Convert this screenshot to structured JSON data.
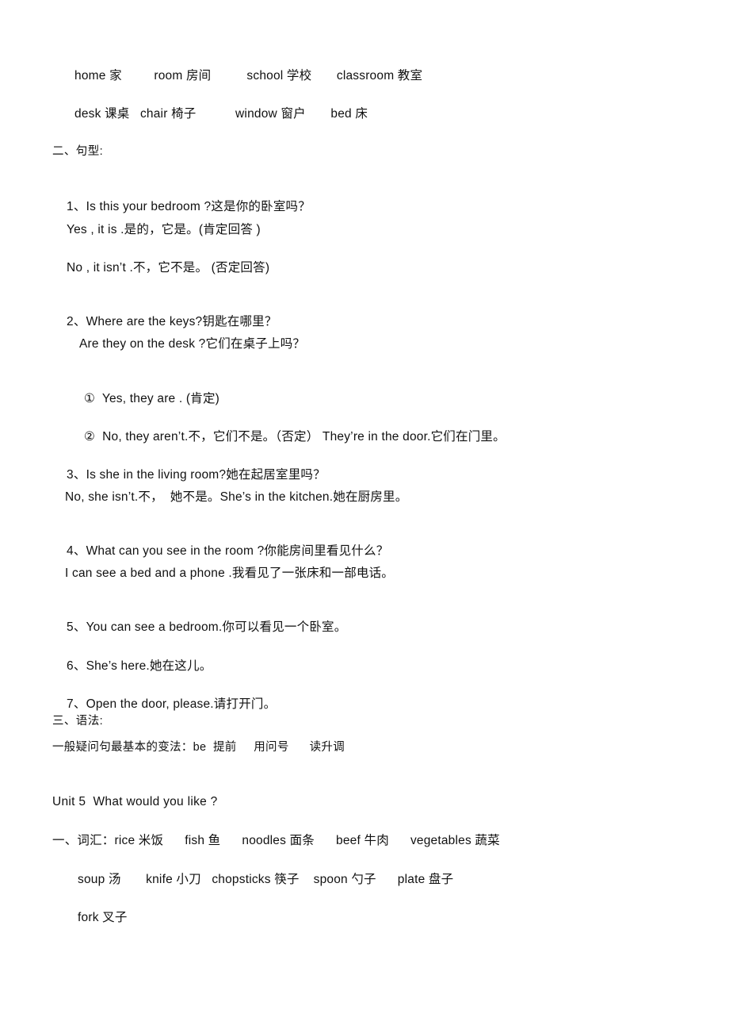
{
  "document": {
    "page_background": "#ffffff",
    "text_color": "#111111"
  },
  "unit4_vocabulary": {
    "row1": "home 家         room 房间          school 学校       classroom 教室",
    "row2": "desk 课桌   chair 椅子           window 窗户       bed 床"
  },
  "sentence_patterns": {
    "heading": "二、句型:",
    "items": [
      {
        "number": "1、",
        "text": "Is this your bedroom ?这是你的卧室吗？",
        "answers": [
          "Yes , it is .是的，它是。(肯定回答 )",
          "No , it isn’t .不，它不是。 (否定回答)"
        ]
      },
      {
        "number": "2、",
        "text": "Where are the keys?钥匙在哪里？",
        "subquestion": "Are they on the desk ?它们在桌子上吗？",
        "choices": [
          {
            "marker": "①",
            "text": "Yes, they are . (肯定)"
          },
          {
            "marker": "②",
            "text": "No, they aren’t.不，它们不是。（否定） They’re in the door.它们在门里。"
          }
        ]
      },
      {
        "number": "3、",
        "text": "Is she in the living room?她在起居室里吗？",
        "answers": [
          "No, she isn’t.不，  她不是。She’s in the kitchen.她在厨房里。"
        ]
      },
      {
        "number": "4、",
        "text": "What can you see in the room ?你能房间里看见什么？",
        "answers": [
          "I can see a bed and a phone .我看见了一张床和一部电话。"
        ]
      },
      {
        "number": "5、",
        "text": "You can see a bedroom.你可以看见一个卧室。",
        "answers": []
      },
      {
        "number": "6、",
        "text": "She’s here.她在这儿。",
        "answers": []
      },
      {
        "number": "7、",
        "text": "Open the door, please.请打开门。",
        "answers": []
      }
    ]
  },
  "grammar": {
    "heading": "三、语法:",
    "note": "一般疑问句最基本的变法：be  提前     用问号      读升调"
  },
  "unit5": {
    "heading": "Unit 5  What would you like ?",
    "vocab_heading_row": "一、词汇：rice 米饭      fish 鱼      noodles 面条      beef 牛肉      vegetables 蔬菜",
    "vocab_row2": "soup 汤       knife 小刀   chopsticks 筷子    spoon 勺子      plate 盘子",
    "vocab_row3": "fork 叉子"
  }
}
